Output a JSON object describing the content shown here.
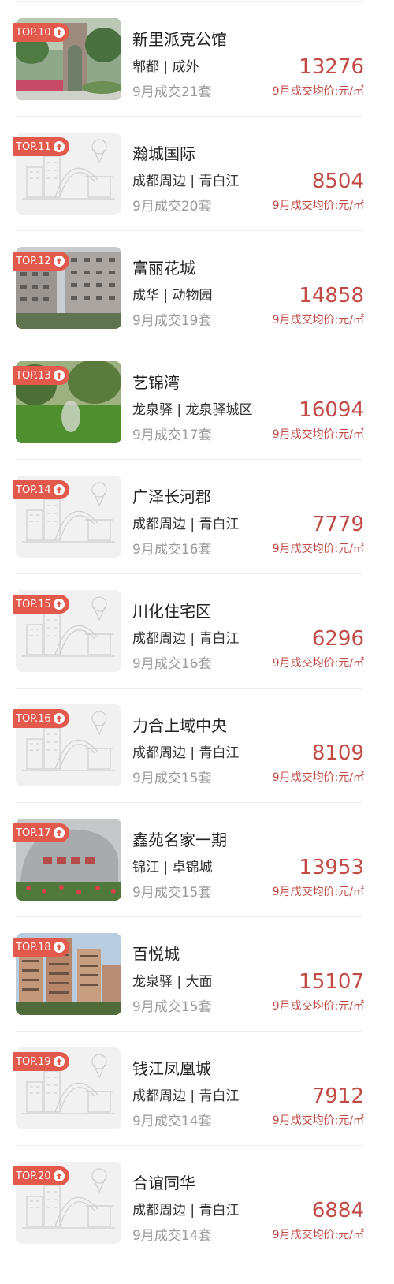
{
  "price_label": "9月成交均价:元/㎡",
  "listings": [
    {
      "rank": "TOP.10",
      "name": "新里派克公馆",
      "location": "郫都 | 成外",
      "sales": "9月成交21套",
      "price": "13276",
      "thumb": "photo-garden-arch"
    },
    {
      "rank": "TOP.11",
      "name": "瀚城国际",
      "location": "成都周边 | 青白江",
      "sales": "9月成交20套",
      "price": "8504",
      "thumb": "placeholder-illustration"
    },
    {
      "rank": "TOP.12",
      "name": "富丽花城",
      "location": "成华 | 动物园",
      "sales": "9月成交19套",
      "price": "14858",
      "thumb": "photo-apartment-blocks"
    },
    {
      "rank": "TOP.13",
      "name": "艺锦湾",
      "location": "龙泉驿 | 龙泉驿城区",
      "sales": "9月成交17套",
      "price": "16094",
      "thumb": "photo-lawn-trees"
    },
    {
      "rank": "TOP.14",
      "name": "广泽长河郡",
      "location": "成都周边 | 青白江",
      "sales": "9月成交16套",
      "price": "7779",
      "thumb": "placeholder-illustration"
    },
    {
      "rank": "TOP.15",
      "name": "川化住宅区",
      "location": "成都周边 | 青白江",
      "sales": "9月成交16套",
      "price": "6296",
      "thumb": "placeholder-illustration"
    },
    {
      "rank": "TOP.16",
      "name": "力合上域中央",
      "location": "成都周边 | 青白江",
      "sales": "9月成交15套",
      "price": "8109",
      "thumb": "placeholder-illustration"
    },
    {
      "rank": "TOP.17",
      "name": "鑫苑名家一期",
      "location": "锦江 | 卓锦城",
      "sales": "9月成交15套",
      "price": "13953",
      "thumb": "photo-stone-sign"
    },
    {
      "rank": "TOP.18",
      "name": "百悦城",
      "location": "龙泉驿 | 大面",
      "sales": "9月成交15套",
      "price": "15107",
      "thumb": "photo-highrise-towers"
    },
    {
      "rank": "TOP.19",
      "name": "钱江凤凰城",
      "location": "成都周边 | 青白江",
      "sales": "9月成交14套",
      "price": "7912",
      "thumb": "placeholder-illustration"
    },
    {
      "rank": "TOP.20",
      "name": "合谊同华",
      "location": "成都周边 | 青白江",
      "sales": "9月成交14套",
      "price": "6884",
      "thumb": "placeholder-illustration"
    }
  ],
  "colors": {
    "accent": "#c24a44",
    "badge": "#e35a4c",
    "muted": "#9a9a9a"
  }
}
